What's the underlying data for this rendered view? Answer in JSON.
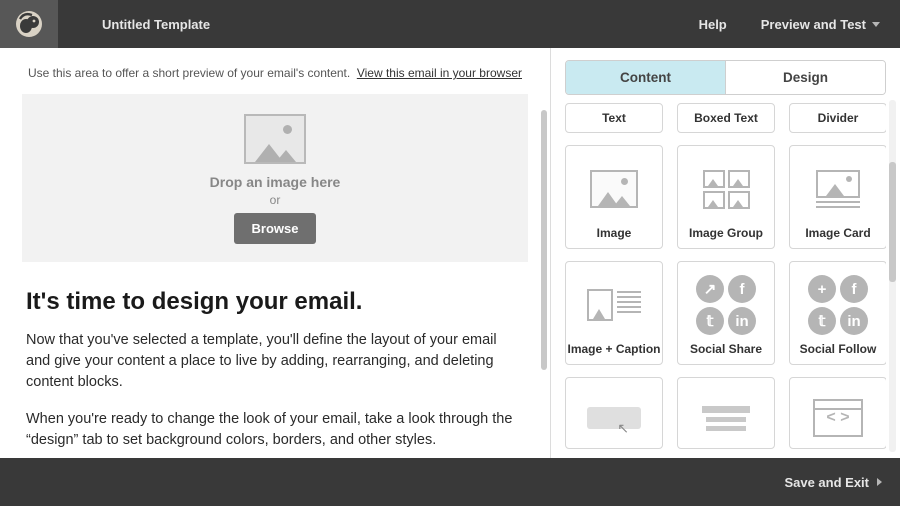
{
  "header": {
    "title": "Untitled Template",
    "help": "Help",
    "preview": "Preview and Test"
  },
  "canvas": {
    "preview_hint": "Use this area to offer a short preview of your email's content.",
    "view_link": "View this email in your browser",
    "drop_title": "Drop an image here",
    "drop_or": "or",
    "browse": "Browse",
    "heading": "It's time to design your email.",
    "p1": "Now that you've selected a template, you'll define the layout of your email and give your content a place to live by adding, rearranging, and deleting content blocks.",
    "p2": "When you're ready to change the look of your email, take a look through the “design” tab to set background colors, borders, and other styles."
  },
  "panel": {
    "tabs": {
      "content": "Content",
      "design": "Design"
    },
    "blocks": {
      "text": "Text",
      "boxed_text": "Boxed Text",
      "divider": "Divider",
      "image": "Image",
      "image_group": "Image Group",
      "image_card": "Image Card",
      "image_caption": "Image + Caption",
      "social_share": "Social Share",
      "social_follow": "Social Follow"
    }
  },
  "footer": {
    "save_exit": "Save and Exit"
  }
}
